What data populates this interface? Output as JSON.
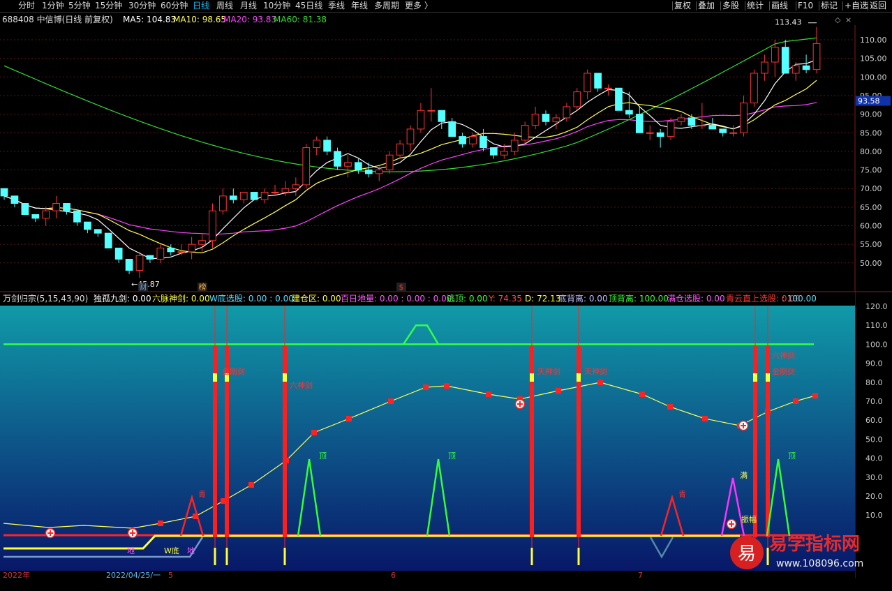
{
  "toolbar": {
    "periods": [
      "分时",
      "1分钟",
      "5分钟",
      "15分钟",
      "30分钟",
      "60分钟",
      "日线",
      "周线",
      "月线",
      "10分钟",
      "45日线",
      "季线",
      "年线",
      "多周期",
      "更多 〉"
    ],
    "active_period": "日线",
    "right_buttons": [
      "复权",
      "叠加",
      "多股",
      "统计",
      "画线",
      "F10",
      "标记",
      "+自选",
      "返回"
    ]
  },
  "main_panel": {
    "stock_title": "688408 中信博(日线 前复权)",
    "indicators": [
      {
        "label": "MA5: 104.83",
        "color": "#ffffff"
      },
      {
        "label": "MA10: 98.65",
        "color": "#ffff55"
      },
      {
        "label": "MA20: 93.83",
        "color": "#ff44ff"
      },
      {
        "label": "MA60: 81.38",
        "color": "#33dd33"
      }
    ],
    "high_label": "113.43",
    "low_label": "45.87",
    "current_price": "93.58",
    "price_ticks": [
      "110.00",
      "105.00",
      "100.00",
      "95.00",
      "90.00",
      "85.00",
      "80.00",
      "75.00",
      "70.00",
      "65.00",
      "60.00",
      "55.00",
      "50.00"
    ],
    "markers": [
      {
        "text": "财",
        "color": "#66aaff"
      },
      {
        "text": "榜",
        "color": "#ffaa33"
      },
      {
        "text": "$",
        "color": "#ff3333"
      }
    ]
  },
  "sub_panel": {
    "title": "万剑归宗(5,15,43,90)",
    "readouts": [
      {
        "label": "独孤九剑: 0.00",
        "color": "#ffffff"
      },
      {
        "label": "六脉神剑: 0.00",
        "color": "#ffff33"
      },
      {
        "label": "W底选股: 0.00  : 0.00",
        "color": "#55ddff"
      },
      {
        "label": "建仓区: 0.00",
        "color": "#ffff33"
      },
      {
        "label": "百日地量: 0.00  : 0.00  : 0.00",
        "color": "#ff55ff"
      },
      {
        "label": "逃顶: 0.00",
        "color": "#33ff33"
      },
      {
        "label": "Y: 74.35",
        "color": "#ff4444"
      },
      {
        "label": "D: 72.13",
        "color": "#ffff33"
      },
      {
        "label": "底背离: 0.00",
        "color": "#bbbbff"
      },
      {
        "label": "顶背离: 100.00",
        "color": "#33ff33"
      },
      {
        "label": "满仓选股: 0.00",
        "color": "#ff55ff"
      },
      {
        "label": "青云直上选股: 0.00",
        "color": "#ff3333"
      },
      {
        "label": ": 100.00",
        "color": "#55ddff"
      }
    ],
    "ticks": [
      "120.0",
      "110.0",
      "100.0",
      "90.0",
      "80.0",
      "70.0",
      "60.0",
      "50.0",
      "40.0",
      "30.0",
      "20.0",
      "10.0"
    ],
    "labels": {
      "qing": "青",
      "ding": "顶",
      "man": "满",
      "zhenfu": "振幅",
      "di": "地",
      "wdi": "W底",
      "tianbao": "天神剑",
      "jingang": "金刚剑",
      "liumai": "六神剑"
    }
  },
  "x_axis": {
    "labels": [
      "2022年",
      "2022/04/25/一",
      "5",
      "6",
      "7"
    ]
  },
  "watermark": {
    "brand": "易学指标网",
    "url": "www.108096.com",
    "logo": "易"
  },
  "colors": {
    "up": "#ff3333",
    "down": "#54ffff",
    "ma5": "#ffffff",
    "ma10": "#ffff55",
    "ma20": "#ff44ff",
    "ma60": "#33dd33"
  },
  "chart_data": {
    "type": "candlestick",
    "ylim": [
      46,
      114
    ],
    "high": 113.43,
    "low": 45.87,
    "ohlc": [
      [
        70,
        70,
        67,
        68
      ],
      [
        68,
        68,
        65,
        66
      ],
      [
        66,
        66,
        63,
        63
      ],
      [
        63,
        63,
        61,
        62
      ],
      [
        62,
        65,
        60,
        64
      ],
      [
        64,
        68,
        62,
        66
      ],
      [
        66,
        66,
        63,
        64
      ],
      [
        64,
        64,
        60,
        61
      ],
      [
        61,
        61,
        58,
        59
      ],
      [
        59,
        59,
        57,
        58
      ],
      [
        58,
        58,
        54,
        54
      ],
      [
        54,
        54,
        50,
        51
      ],
      [
        51,
        51,
        47,
        48
      ],
      [
        48,
        53,
        46,
        52
      ],
      [
        52,
        52,
        50,
        51
      ],
      [
        51,
        55,
        50,
        54
      ],
      [
        54,
        55,
        52,
        53
      ],
      [
        53,
        55,
        52,
        53
      ],
      [
        53,
        57,
        51,
        55
      ],
      [
        55,
        58,
        53,
        56
      ],
      [
        56,
        66,
        54,
        64
      ],
      [
        64,
        70,
        63,
        68
      ],
      [
        68,
        70,
        66,
        67
      ],
      [
        67,
        69,
        66,
        69
      ],
      [
        69,
        69,
        67,
        67
      ],
      [
        67,
        70,
        66,
        69
      ],
      [
        69,
        71,
        68,
        69
      ],
      [
        69,
        72,
        68,
        70
      ],
      [
        70,
        73,
        68,
        71
      ],
      [
        71,
        82,
        70,
        81
      ],
      [
        81,
        84,
        79,
        83
      ],
      [
        83,
        84,
        79,
        80
      ],
      [
        80,
        81,
        75,
        76
      ],
      [
        76,
        79,
        73,
        77
      ],
      [
        77,
        78,
        74,
        75
      ],
      [
        75,
        77,
        73,
        74
      ],
      [
        74,
        76,
        72,
        75
      ],
      [
        75,
        80,
        74,
        79
      ],
      [
        79,
        83,
        78,
        82
      ],
      [
        82,
        87,
        80,
        86
      ],
      [
        86,
        93,
        85,
        91
      ],
      [
        91,
        97,
        88,
        91
      ],
      [
        91,
        91,
        86,
        88
      ],
      [
        88,
        89,
        84,
        84
      ],
      [
        84,
        85,
        81,
        82
      ],
      [
        82,
        85,
        81,
        84
      ],
      [
        84,
        86,
        80,
        81
      ],
      [
        81,
        81,
        78,
        79
      ],
      [
        79,
        82,
        78,
        80
      ],
      [
        80,
        85,
        79,
        83
      ],
      [
        83,
        88,
        82,
        87
      ],
      [
        87,
        92,
        86,
        90
      ],
      [
        90,
        91,
        87,
        88
      ],
      [
        88,
        90,
        86,
        89
      ],
      [
        89,
        93,
        88,
        92
      ],
      [
        92,
        97,
        91,
        96
      ],
      [
        96,
        102,
        94,
        101
      ],
      [
        101,
        101,
        96,
        97
      ],
      [
        97,
        98,
        95,
        97
      ],
      [
        97,
        97,
        92,
        91
      ],
      [
        91,
        96,
        89,
        90
      ],
      [
        90,
        92,
        85,
        85
      ],
      [
        85,
        87,
        83,
        85
      ],
      [
        85,
        86,
        81,
        84
      ],
      [
        84,
        89,
        83,
        88
      ],
      [
        88,
        90,
        87,
        89
      ],
      [
        89,
        90,
        86,
        87
      ],
      [
        87,
        93,
        86,
        87
      ],
      [
        87,
        89,
        86,
        86
      ],
      [
        86,
        86,
        84,
        85
      ],
      [
        85,
        87,
        84,
        85
      ],
      [
        85,
        95,
        84,
        93
      ],
      [
        93,
        102,
        92,
        101
      ],
      [
        101,
        106,
        99,
        104
      ],
      [
        104,
        110,
        100,
        108
      ],
      [
        108,
        110,
        102,
        101
      ],
      [
        101,
        104,
        99,
        103
      ],
      [
        103,
        106,
        101,
        102
      ],
      [
        102,
        113.43,
        101,
        109
      ]
    ],
    "series": [
      {
        "name": "MA5",
        "values": [
          104.83
        ]
      },
      {
        "name": "MA10",
        "values": [
          98.65
        ]
      },
      {
        "name": "MA20",
        "values": [
          93.83
        ]
      },
      {
        "name": "MA60",
        "values": [
          81.38
        ]
      }
    ]
  }
}
